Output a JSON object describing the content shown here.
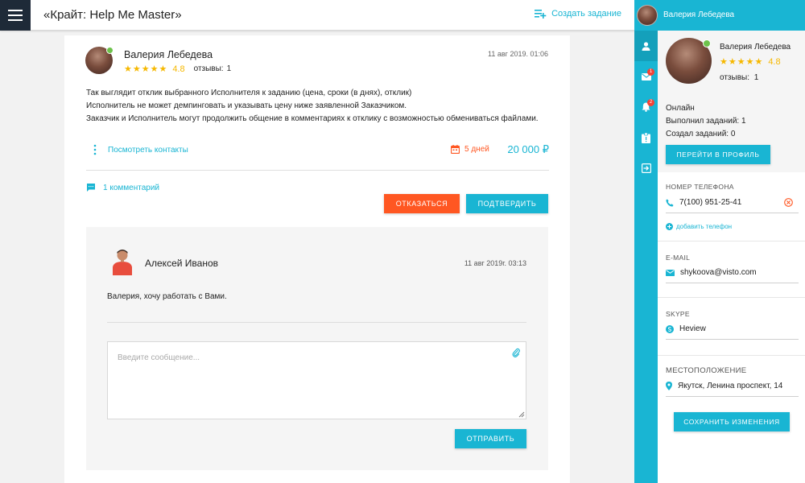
{
  "header": {
    "title": "«Крайт: Help Me Master»",
    "create_task_label": "Создать задание"
  },
  "offer": {
    "user_name": "Валерия Лебедева",
    "stars": "★★★★★",
    "rating": "4.8",
    "reviews_label": "отзывы:",
    "reviews_count": "1",
    "timestamp": "11 авг 2019. 01:06",
    "description_lines": [
      "Так выглядит отклик выбранного Исполнителя к заданию (цена, сроки (в днях), отклик)",
      "Исполнитель не может демпинговать и указывать цену ниже заявленной Заказчиком.",
      "Заказчик и Исполнитель могут продолжить общение в комментариях к отклику с возможностью обмениваться файлами."
    ],
    "view_contacts_label": "Посмотреть контакты",
    "days_label": "5 дней",
    "price": "20 000 ₽",
    "comments_label": "1 комментарий",
    "refuse_label": "ОТКАЗАТЬСЯ",
    "confirm_label": "ПОДТВЕРДИТЬ"
  },
  "comment": {
    "author": "Алексей Иванов",
    "timestamp": "11 авг 2019г. 03:13",
    "text": "Валерия, хочу работать с Вами.",
    "message_placeholder": "Введите сообщение...",
    "message_value": "",
    "send_label": "ОТПРАВИТЬ"
  },
  "sidebar": {
    "header_name": "Валерия Лебедева",
    "messages_badge": "1",
    "notifications_badge": "2",
    "icons": [
      "person-icon",
      "mail-icon",
      "bell-icon",
      "clipboard-icon",
      "logout-icon"
    ]
  },
  "profile": {
    "name": "Валерия Лебедева",
    "stars": "★★★★★",
    "rating": "4.8",
    "reviews_label": "отзывы:",
    "reviews_count": "1",
    "status": "Онлайн",
    "completed_label": "Выполнил заданий: 1",
    "created_label": "Создал заданий: 0",
    "go_profile_label": "ПЕРЕЙТИ В ПРОФИЛЬ",
    "phone_label": "НОМЕР ТЕЛЕФОНА",
    "phone_value": "7(100) 951-25-41",
    "add_phone_label": "добавить телефон",
    "email_label": "E-MAIL",
    "email_value": "shykoova@visto.com",
    "skype_label": "SKYPE",
    "skype_value": "Heview",
    "location_label": "МЕСТОПОЛОЖЕНИЕ",
    "location_value": "Якутск, Ленина проспект, 14",
    "save_label": "СОХРАНИТЬ ИЗМЕНЕНИЯ"
  },
  "colors": {
    "accent": "#19b5d3",
    "danger": "#ff5722",
    "star": "#f6b800",
    "online": "#6dc24b",
    "menu_bg": "#1e2a38"
  }
}
